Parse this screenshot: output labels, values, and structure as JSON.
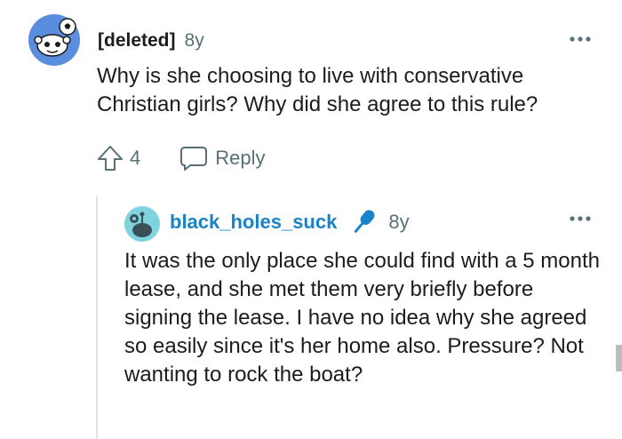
{
  "top_comment": {
    "author": "[deleted]",
    "age": "8y",
    "body": "Why is she choosing to live with conservative Christian girls? Why did she agree to this rule?",
    "avatar_icon": "snoo-avatar-icon",
    "more_icon": "more-options-icon"
  },
  "actions": {
    "upvote_icon": "upvote-arrow-icon",
    "vote_count": "4",
    "reply_icon": "speech-bubble-icon",
    "reply_label": "Reply"
  },
  "reply_comment": {
    "author": "black_holes_suck",
    "age": "8y",
    "body": "It was the only place she could find with a 5 month lease, and she met them very briefly before signing the lease. I have no idea why she agreed so easily since it's her home also. Pressure? Not wanting to rock the boat?",
    "avatar_icon": "user-avatar-icon",
    "flair_icon": "microphone-icon",
    "more_icon": "more-options-icon"
  },
  "colors": {
    "text": "#1c1c1c",
    "muted": "#576f76",
    "reply_author": "#1a82c8",
    "avatar_top_bg": "#5b8ddf",
    "avatar_reply_bg": "#7fd3dc"
  }
}
